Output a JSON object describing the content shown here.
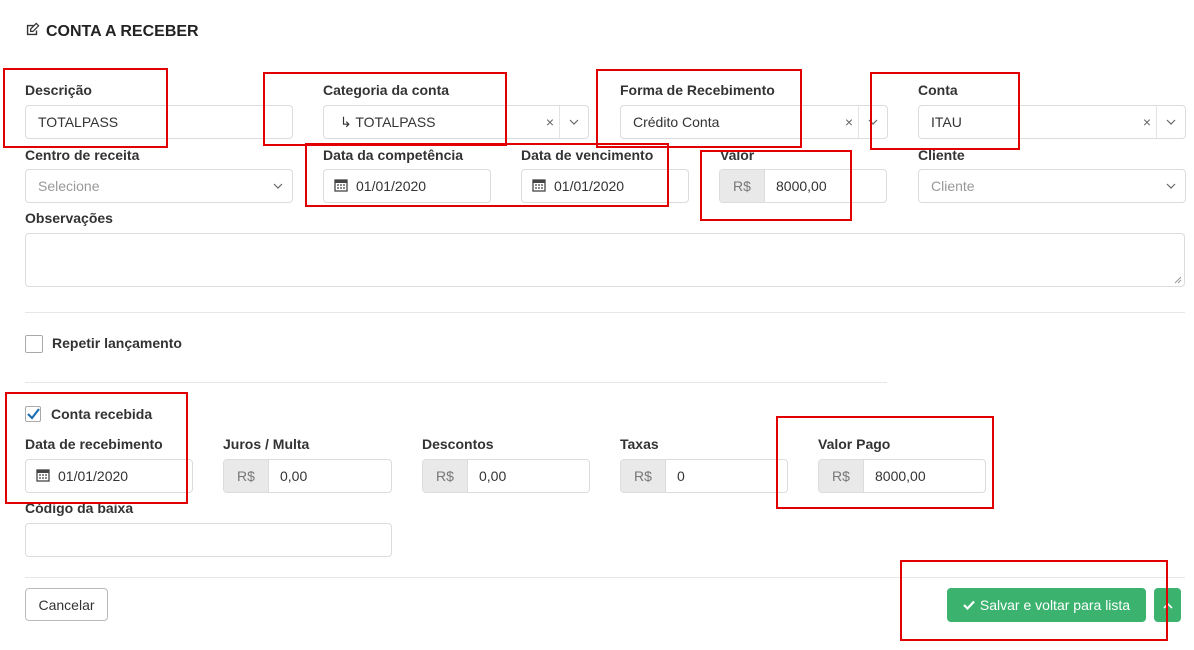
{
  "header": {
    "title": "CONTA A RECEBER"
  },
  "fields": {
    "descricao": {
      "label": "Descrição",
      "value": "TOTALPASS"
    },
    "categoria": {
      "label": "Categoria da conta",
      "value": "↳ TOTALPASS"
    },
    "forma": {
      "label": "Forma de Recebimento",
      "value": "Crédito Conta"
    },
    "conta": {
      "label": "Conta",
      "value": "ITAU"
    },
    "centro": {
      "label": "Centro de receita",
      "placeholder": "Selecione"
    },
    "competencia": {
      "label": "Data da competência",
      "value": "01/01/2020"
    },
    "vencimento": {
      "label": "Data de vencimento",
      "value": "01/01/2020"
    },
    "valor": {
      "label": "Valor",
      "prefix": "R$",
      "value": "8000,00"
    },
    "cliente": {
      "label": "Cliente",
      "placeholder": "Cliente"
    },
    "observacoes": {
      "label": "Observações",
      "value": ""
    }
  },
  "repetir": {
    "label": "Repetir lançamento",
    "checked": false
  },
  "recebida": {
    "label": "Conta recebida",
    "checked": true
  },
  "payment": {
    "data_recebimento": {
      "label": "Data de recebimento",
      "value": "01/01/2020"
    },
    "juros": {
      "label": "Juros / Multa",
      "prefix": "R$",
      "value": "0,00"
    },
    "descontos": {
      "label": "Descontos",
      "prefix": "R$",
      "value": "0,00"
    },
    "taxas": {
      "label": "Taxas",
      "prefix": "R$",
      "value": "0"
    },
    "valor_pago": {
      "label": "Valor Pago",
      "prefix": "R$",
      "value": "8000,00"
    },
    "codigo_baixa": {
      "label": "Código da baixa",
      "value": ""
    }
  },
  "footer": {
    "cancel_label": "Cancelar",
    "save_label": "Salvar e voltar para lista"
  },
  "colors": {
    "accent_green": "#3bb36f",
    "highlight_red": "#e00000",
    "check_blue": "#1f6fb2"
  },
  "icons": [
    "edit-icon",
    "calendar-icon",
    "check-icon",
    "chevron-down-icon",
    "close-icon",
    "chevron-up-icon"
  ]
}
